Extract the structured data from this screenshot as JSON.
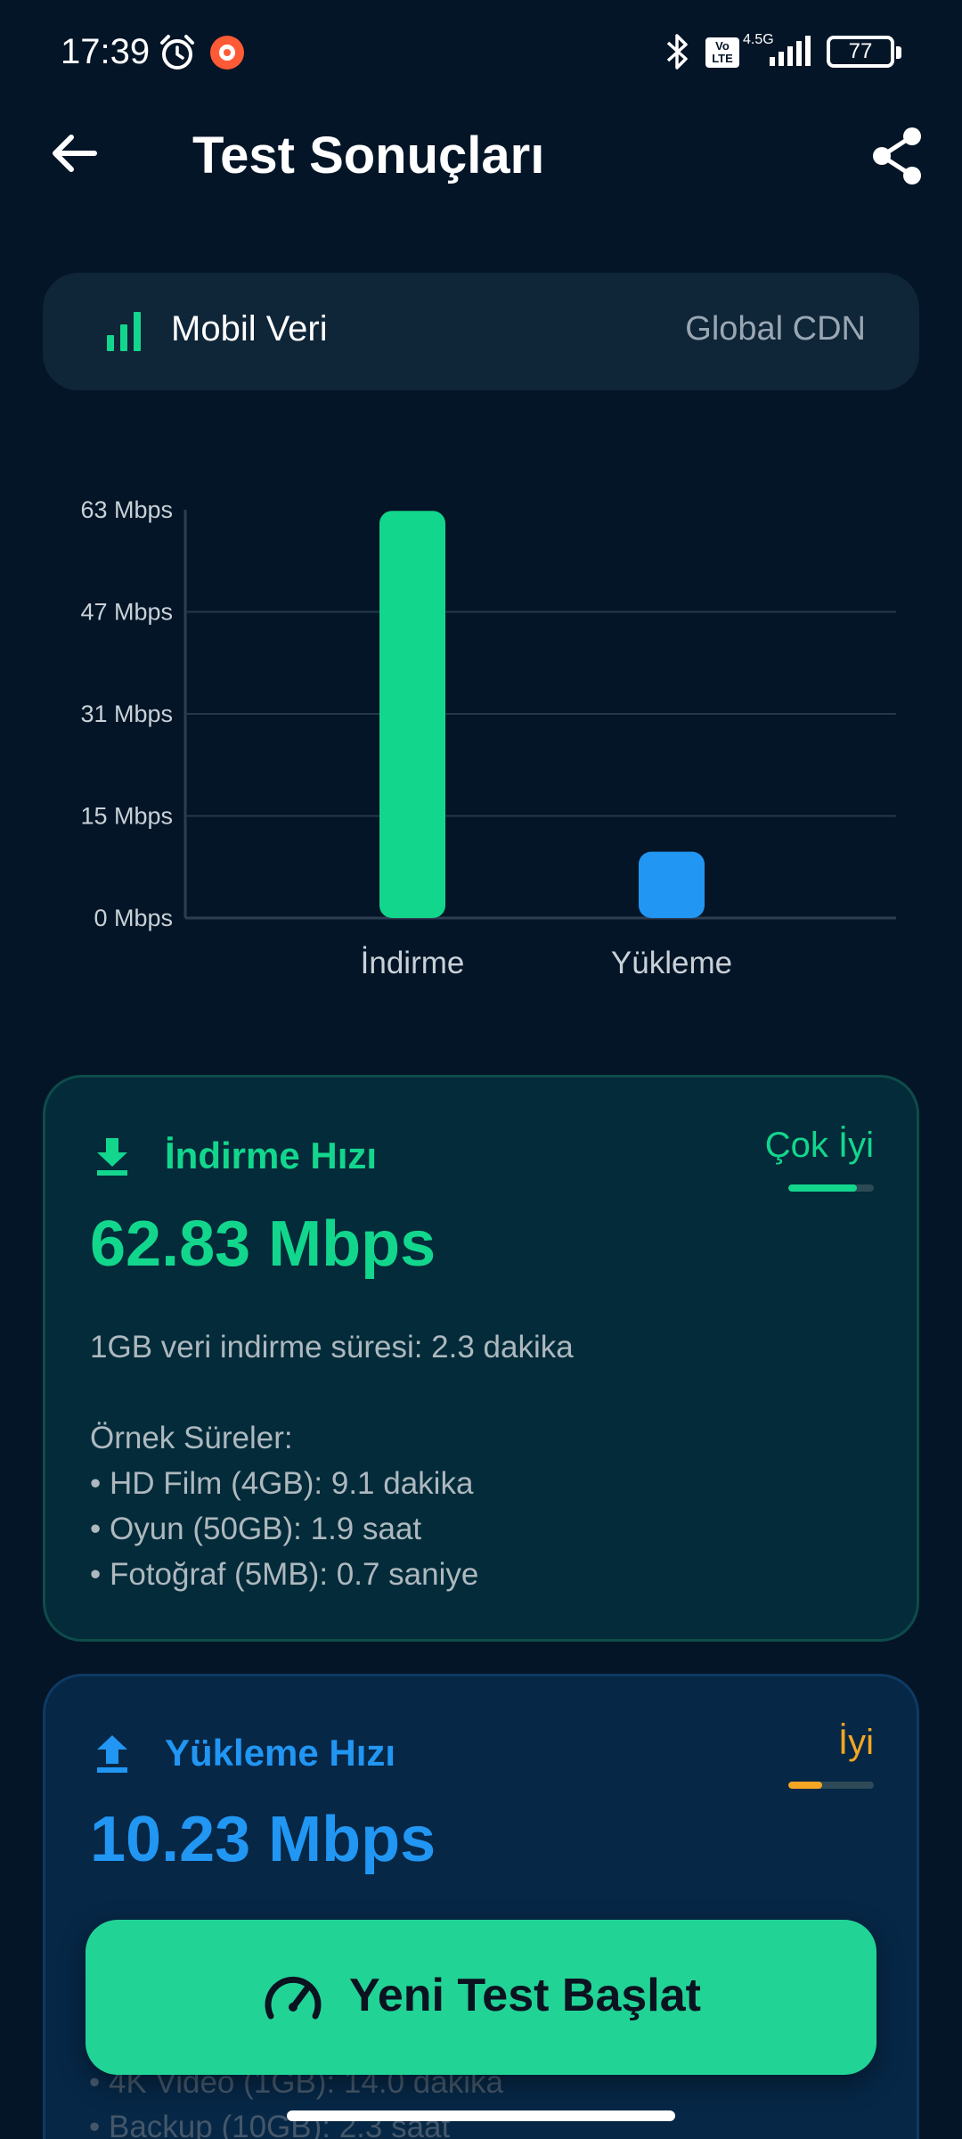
{
  "status": {
    "time": "17:39",
    "network_label": "4.5G",
    "volte": "Vo LTE",
    "battery": "77"
  },
  "appbar": {
    "title": "Test Sonuçları"
  },
  "connection": {
    "type": "Mobil Veri",
    "server": "Global CDN"
  },
  "chart_data": {
    "type": "bar",
    "categories": [
      "İndirme",
      "Yükleme"
    ],
    "values": [
      62.83,
      10.23
    ],
    "colors": [
      "#13d68d",
      "#2196f3"
    ],
    "ytick_labels": [
      "0 Mbps",
      "15 Mbps",
      "31 Mbps",
      "47 Mbps",
      "63 Mbps"
    ],
    "yticks": [
      0,
      15.75,
      31.5,
      47.25,
      63
    ],
    "ylim": [
      0,
      63
    ],
    "grid": true
  },
  "download": {
    "title": "İndirme Hızı",
    "rating": "Çok İyi",
    "rating_level": 0.8,
    "speed": "62.83 Mbps",
    "detail": "1GB veri indirme süresi: 2.3 dakika",
    "examples_header": "Örnek Süreler:",
    "examples": [
      "• HD Film (4GB): 9.1 dakika",
      "• Oyun (50GB): 1.9 saat",
      "• Fotoğraf (5MB): 0.7 saniye"
    ]
  },
  "upload": {
    "title": "Yükleme Hızı",
    "rating": "İyi",
    "rating_level": 0.4,
    "speed": "10.23 Mbps",
    "faded_lines": [
      "• 4K Video (1GB): 14.0 dakika",
      "• Backup (10GB): 2.3 saat"
    ]
  },
  "actions": {
    "new_test": "Yeni Test Başlat"
  },
  "colors": {
    "background": "#041527",
    "download_accent": "#13d68d",
    "upload_accent": "#2196f3",
    "rating_excellent": "#13d68d",
    "rating_good": "#f5a623",
    "button": "#22d396"
  }
}
